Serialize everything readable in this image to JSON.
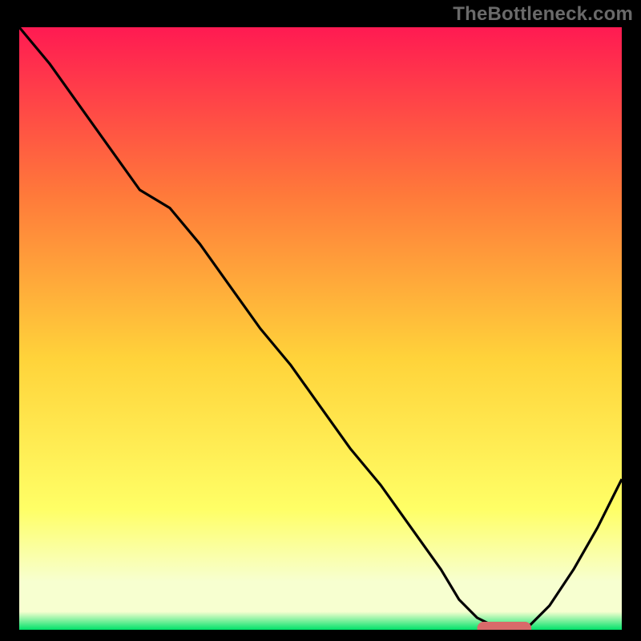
{
  "watermark": "TheBottleneck.com",
  "colors": {
    "background": "#000000",
    "watermark_text": "#6a6a6a",
    "gradient_top": "#ff1a52",
    "gradient_mid_upper": "#ff7a3a",
    "gradient_mid": "#ffd33a",
    "gradient_mid_lower": "#ffff66",
    "gradient_low": "#f7ffd0",
    "gradient_bottom": "#00e26a",
    "curve": "#000000",
    "marker": "#d86a6a"
  },
  "plot_geometry": {
    "x_offset": 24,
    "y_offset": 34,
    "inner_width": 752,
    "inner_height": 752
  },
  "chart_data": {
    "type": "line",
    "title": "",
    "xlabel": "",
    "ylabel": "",
    "xlim": [
      0,
      100
    ],
    "ylim": [
      0,
      100
    ],
    "grid": false,
    "legend": false,
    "series": [
      {
        "name": "bottleneck-curve",
        "x": [
          0,
          5,
          10,
          15,
          20,
          25,
          30,
          35,
          40,
          45,
          50,
          55,
          60,
          65,
          70,
          73,
          76,
          80,
          84,
          88,
          92,
          96,
          100
        ],
        "values": [
          100,
          94,
          87,
          80,
          73,
          70,
          64,
          57,
          50,
          44,
          37,
          30,
          24,
          17,
          10,
          5,
          2,
          0,
          0,
          4,
          10,
          17,
          25
        ]
      }
    ],
    "annotations": [
      {
        "name": "optimal-marker",
        "shape": "rounded-bar",
        "x_range": [
          76,
          85
        ],
        "y": 0
      }
    ]
  }
}
